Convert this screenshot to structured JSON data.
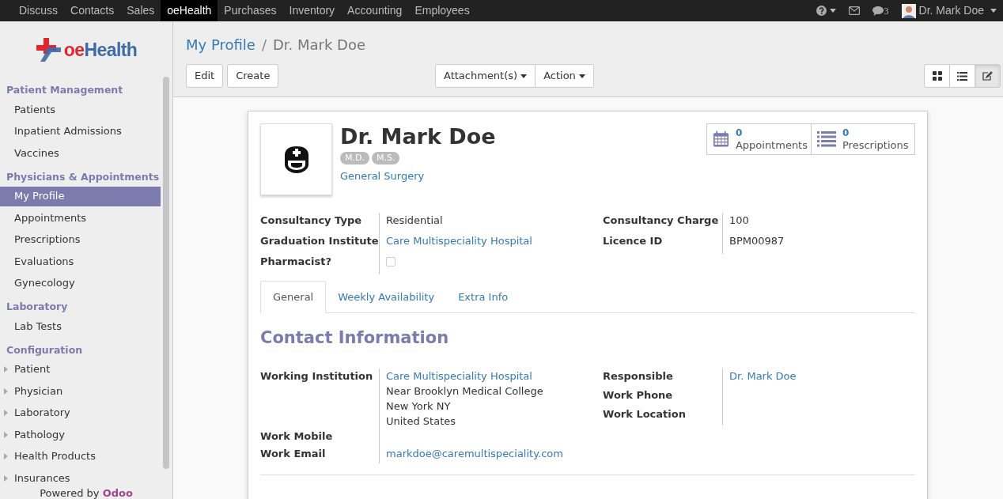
{
  "topbar": {
    "apps": [
      {
        "label": "Discuss",
        "selected": false
      },
      {
        "label": "Contacts",
        "selected": false
      },
      {
        "label": "Sales",
        "selected": false
      },
      {
        "label": "oeHealth",
        "selected": true
      },
      {
        "label": "Purchases",
        "selected": false
      },
      {
        "label": "Inventory",
        "selected": false
      },
      {
        "label": "Accounting",
        "selected": false
      },
      {
        "label": "Employees",
        "selected": false
      }
    ],
    "chat_count": "3",
    "user": "Dr. Mark Doe"
  },
  "logo": {
    "parts": [
      {
        "text": "oe",
        "color": "#e0262b"
      },
      {
        "text": "Health",
        "color": "#3f6aa6"
      }
    ]
  },
  "sidebar": {
    "sections": [
      {
        "title": "Patient Management",
        "items": [
          {
            "label": "Patients",
            "selected": false
          },
          {
            "label": "Inpatient Admissions",
            "selected": false
          },
          {
            "label": "Vaccines",
            "selected": false
          }
        ]
      },
      {
        "title": "Physicians & Appointments",
        "items": [
          {
            "label": "My Profile",
            "selected": true
          },
          {
            "label": "Appointments",
            "selected": false
          },
          {
            "label": "Prescriptions",
            "selected": false
          },
          {
            "label": "Evaluations",
            "selected": false
          },
          {
            "label": "Gynecology",
            "selected": false
          }
        ]
      },
      {
        "title": "Laboratory",
        "items": [
          {
            "label": "Lab Tests",
            "selected": false
          }
        ]
      },
      {
        "title": "Configuration",
        "items": [
          {
            "label": "Patient",
            "selected": false,
            "expanded": false
          },
          {
            "label": "Physician",
            "selected": false,
            "expanded": false
          },
          {
            "label": "Laboratory",
            "selected": false,
            "expanded": false
          },
          {
            "label": "Pathology",
            "selected": false,
            "expanded": false
          },
          {
            "label": "Health Products",
            "selected": false,
            "expanded": false
          },
          {
            "label": "Insurances",
            "selected": false,
            "expanded": false
          }
        ]
      }
    ],
    "footer": {
      "prefix": "Powered by",
      "brand": "Odoo"
    }
  },
  "breadcrumb_separator": "/",
  "breadcrumb": [
    {
      "label": "My Profile"
    },
    {
      "label": "Dr. Mark Doe"
    }
  ],
  "buttons": [
    "Edit",
    "Create"
  ],
  "dropdowns": [
    "Attachment(s)",
    "Action"
  ],
  "views": [
    {
      "kind": "kanban",
      "selected": false
    },
    {
      "kind": "list",
      "selected": false
    },
    {
      "kind": "form",
      "selected": true
    }
  ],
  "sheet": {
    "name": "Dr. Mark Doe",
    "tags": [
      "M.D.",
      "M.S."
    ],
    "speciality": "General Surgery",
    "stats": [
      {
        "kind": "calendar",
        "count": "0",
        "label": "Appointments"
      },
      {
        "kind": "list",
        "count": "0",
        "label": "Prescriptions"
      }
    ],
    "fields_left": [
      {
        "label": "Consultancy Type",
        "kind": "text",
        "value": "Residential"
      },
      {
        "label": "Graduation Institute",
        "kind": "link",
        "value": "Care Multispeciality Hospital"
      },
      {
        "label": "Pharmacist?",
        "kind": "checkbox",
        "checked": false
      }
    ],
    "fields_right": [
      {
        "label": "Consultancy Charge",
        "kind": "text",
        "value": "100"
      },
      {
        "label": "Licence ID",
        "kind": "text",
        "value": "BPM00987"
      }
    ],
    "tabs": [
      {
        "label": "General",
        "selected": true
      },
      {
        "label": "Weekly Availability",
        "selected": false
      },
      {
        "label": "Extra Info",
        "selected": false
      }
    ],
    "section_title": "Contact Information",
    "contact_left": [
      {
        "label": "Working Institution",
        "kind": "address",
        "lines": [
          "Care Multispeciality Hospital",
          "Near Brooklyn Medical College",
          "New York NY",
          "United States"
        ]
      },
      {
        "label": "Work Mobile",
        "kind": "empty"
      },
      {
        "label": "Work Email",
        "kind": "link",
        "value": "markdoe@caremultispeciality.com"
      }
    ],
    "contact_right": [
      {
        "label": "Responsible",
        "kind": "link",
        "value": "Dr. Mark Doe"
      },
      {
        "label": "Work Phone",
        "kind": "empty"
      },
      {
        "label": "Work Location",
        "kind": "empty"
      }
    ]
  }
}
